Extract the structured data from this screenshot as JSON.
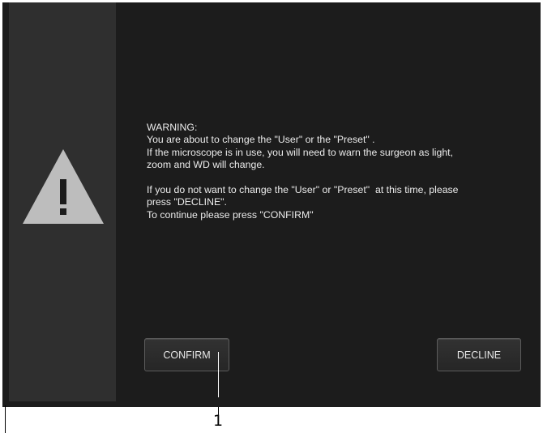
{
  "dialog": {
    "icon": "warning-triangle-icon",
    "message": {
      "heading": "WARNING:",
      "line1": "You are about to change the \"User\" or the \"Preset\" .",
      "line2": "If the microscope is in use, you will need to warn the surgeon as light,",
      "line3": "zoom and WD will change.",
      "line4": "If you do not want to change the \"User\" or \"Preset\"  at this time, please",
      "line5": "press \"DECLINE\".",
      "line6": "To continue please press \"CONFIRM\""
    },
    "confirm_label": "CONFIRM",
    "decline_label": "DECLINE"
  },
  "callout": {
    "number": "1"
  },
  "colors": {
    "background": "#1c1c1c",
    "side_panel": "#2f2f2f",
    "icon": "#bdbdbd",
    "text": "#ebebeb"
  }
}
